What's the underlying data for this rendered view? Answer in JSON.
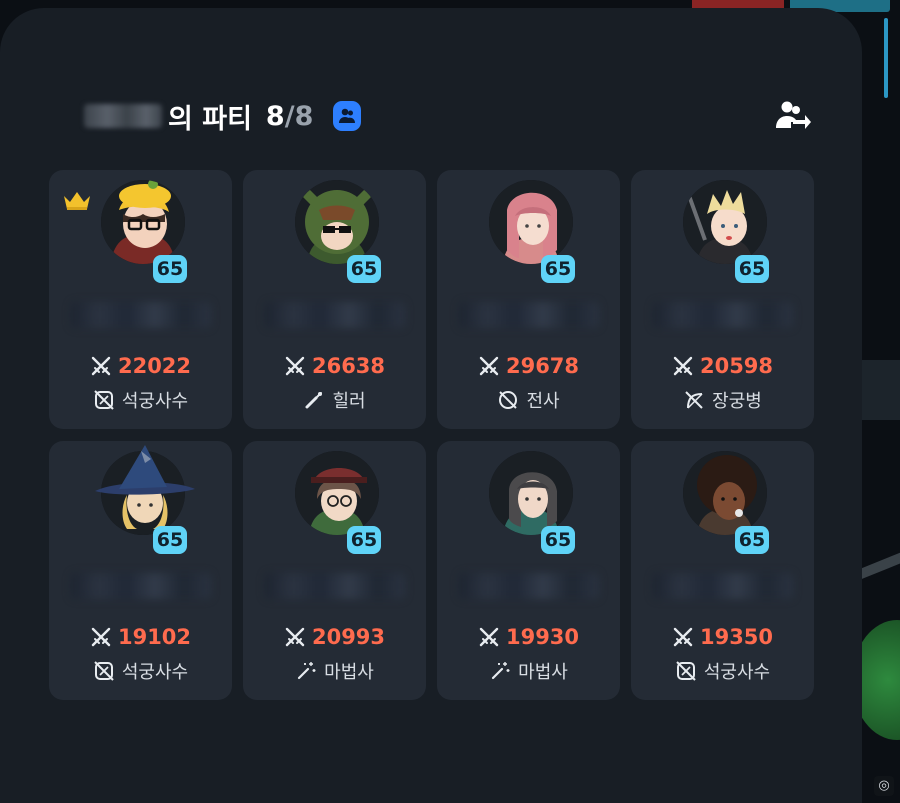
{
  "party": {
    "suffix": "의 파티",
    "count_current": "8",
    "count_separator": "/",
    "count_max": "8"
  },
  "icons": {
    "party_icon": "party-people-icon",
    "leave_icon": "leave-party-icon",
    "crown_icon": "leader-crown-icon",
    "power_icon": "crossed-swords-icon"
  },
  "members": [
    {
      "level": "65",
      "power": "22022",
      "class": "석궁사수",
      "class_icon": "crossbow-icon",
      "is_leader": true
    },
    {
      "level": "65",
      "power": "26638",
      "class": "힐러",
      "class_icon": "healer-wand-icon",
      "is_leader": false
    },
    {
      "level": "65",
      "power": "29678",
      "class": "전사",
      "class_icon": "warrior-shield-icon",
      "is_leader": false
    },
    {
      "level": "65",
      "power": "20598",
      "class": "장궁병",
      "class_icon": "longbow-icon",
      "is_leader": false
    },
    {
      "level": "65",
      "power": "19102",
      "class": "석궁사수",
      "class_icon": "crossbow-icon",
      "is_leader": false
    },
    {
      "level": "65",
      "power": "20993",
      "class": "마법사",
      "class_icon": "magic-wand-icon",
      "is_leader": false
    },
    {
      "level": "65",
      "power": "19930",
      "class": "마법사",
      "class_icon": "magic-wand-icon",
      "is_leader": false
    },
    {
      "level": "65",
      "power": "19350",
      "class": "석궁사수",
      "class_icon": "crossbow-icon",
      "is_leader": false
    }
  ],
  "colors": {
    "panel_bg": "#181e25",
    "card_bg": "#242b35",
    "power_text": "#ff6b4e",
    "level_badge": "#5fd3f7",
    "party_icon_bg": "#2d7fff",
    "crown": "#f3c12c"
  }
}
